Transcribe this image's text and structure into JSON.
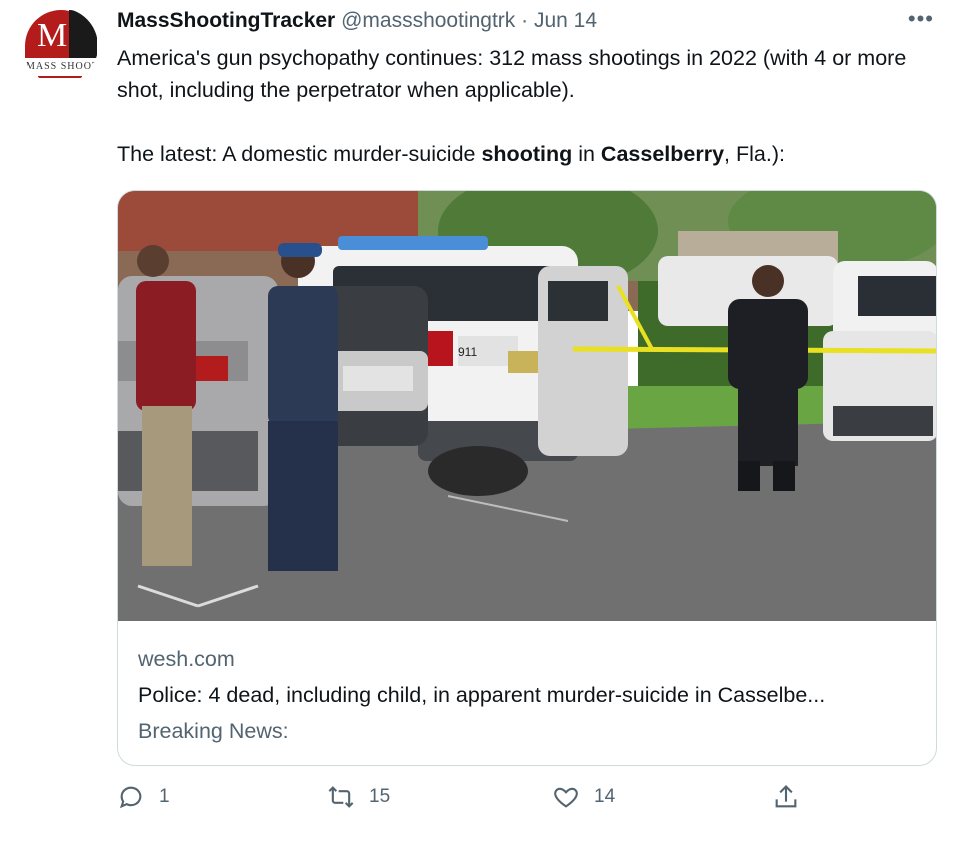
{
  "tweet": {
    "display_name": "MassShootingTracker",
    "handle": "@massshootingtrk",
    "separator": "·",
    "date": "Jun 14",
    "more_icon": "more-icon",
    "paragraph1": "America's gun psychopathy continues: 312 mass shootings in 2022 (with 4 or more shot, including the perpetrator when applicable).",
    "p2_a": "The latest: A domestic murder-suicide ",
    "p2_b": "shooting",
    "p2_c": " in ",
    "p2_d": "Casselberry",
    "p2_e": ", Fla.):"
  },
  "avatar": {
    "letter": "M",
    "caption": "MASS SHOOT"
  },
  "card": {
    "domain": "wesh.com",
    "headline": "Police: 4 dead, including child, in apparent murder-suicide in Casselbe...",
    "description": "Breaking News:",
    "vehicle_number": "911"
  },
  "actions": {
    "reply_count": "1",
    "retweet_count": "15",
    "like_count": "14"
  },
  "colors": {
    "text": "#0f1419",
    "secondary": "#536471",
    "border": "#cfd9de",
    "brand_red": "#b41b1b",
    "caution_tape": "#e8e020"
  }
}
